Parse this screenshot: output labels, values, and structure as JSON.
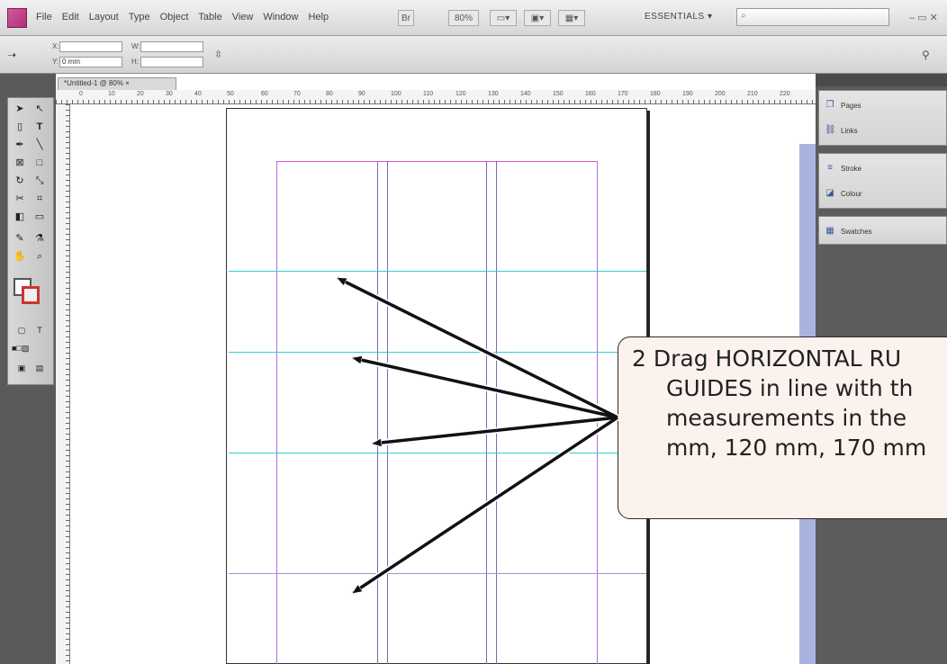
{
  "menubar": {
    "items": [
      "File",
      "Edit",
      "Layout",
      "Type",
      "Object",
      "Table",
      "View",
      "Window",
      "Help"
    ],
    "zoom_value": "80%",
    "workspace": "ESSENTIALS ▾"
  },
  "controlbar": {
    "y_value": "0 mm"
  },
  "document": {
    "tab_title": "*Untitled-1 @ 80% ×",
    "ruler_ticks": [
      "0",
      "10",
      "20",
      "30",
      "40",
      "50",
      "60",
      "70",
      "80",
      "90",
      "100",
      "110",
      "120",
      "130",
      "140",
      "150",
      "160",
      "170",
      "180",
      "190",
      "200",
      "210",
      "220"
    ]
  },
  "panels": {
    "group1": [
      "Pages",
      "Links"
    ],
    "group2": [
      "Stroke",
      "Colour"
    ],
    "group3": [
      "Swatches"
    ]
  },
  "callout": {
    "lines": [
      "2  Drag HORIZONTAL RU",
      "GUIDES in line with th",
      "measurements in the",
      "mm, 120 mm, 170 mm"
    ]
  },
  "colors": {
    "margin_guide": "#e050d0",
    "column_guide": "#7a68b0",
    "ruler_guide": "#30d0d0",
    "callout_bg": "#fbf2ee"
  }
}
